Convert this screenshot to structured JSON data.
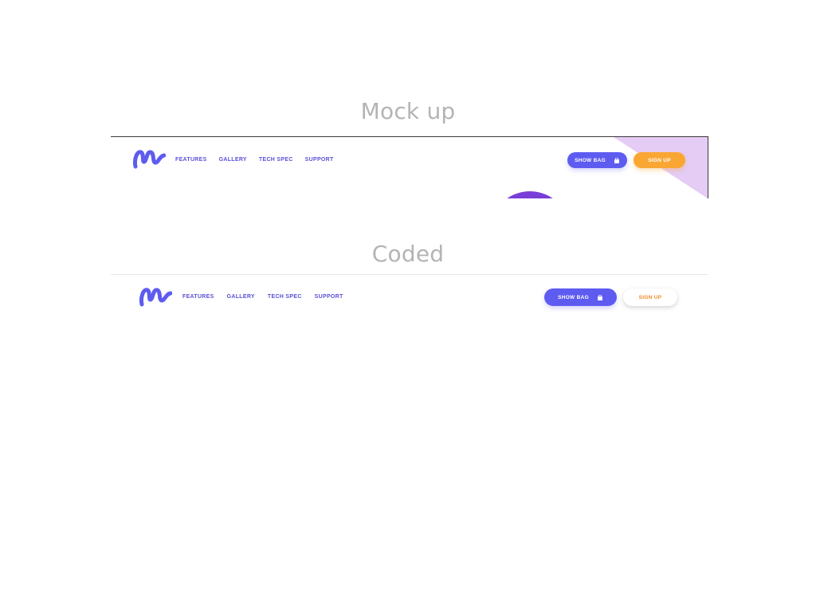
{
  "headings": {
    "mockup": "Mock up",
    "coded": "Coded"
  },
  "logo": {
    "icon": "m-swirl-logo-icon",
    "color": "#5e5cf0"
  },
  "mockup": {
    "nav": [
      "FEATURES",
      "GALLERY",
      "TECH SPEC",
      "SUPPORT"
    ],
    "show_bag_label": "SHOW BAG",
    "sign_up_label": "SIGN UP",
    "colors": {
      "accent": "#5e5cf0",
      "sign_up": "#f9a633",
      "triangle": "#e5ccf5",
      "circle": "#6a36d0"
    }
  },
  "coded": {
    "nav": [
      "FEATURES",
      "GALLERY",
      "TECH SPEC",
      "SUPPORT"
    ],
    "show_bag_label": "SHOW BAG",
    "sign_up_label": "SIGN UP",
    "colors": {
      "accent": "#5e5cf0",
      "sign_up_text": "#f08a24"
    }
  },
  "icons": {
    "bag": "shopping-bag-icon"
  }
}
